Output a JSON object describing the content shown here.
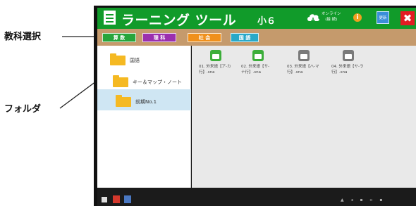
{
  "callouts": {
    "subject_select": "教科選択",
    "folder": "フォルダ"
  },
  "header": {
    "app_title": "ラーニング ツール",
    "grade": "小６",
    "online_status_line1": "オンライン",
    "online_status_line2": "(接 続)",
    "info_label": "i",
    "update_label": "更新",
    "close_label": "✖"
  },
  "subjects": [
    {
      "label": "算 数",
      "color": "#27a53b"
    },
    {
      "label": "理 科",
      "color": "#9b2fae"
    },
    {
      "label": "社 会",
      "color": "#f0901c"
    },
    {
      "label": "国 語",
      "color": "#29a9c8"
    }
  ],
  "folders": [
    {
      "label": "国語"
    },
    {
      "label": "キー＆マップ・ノート"
    },
    {
      "label": "前期No.1"
    }
  ],
  "files": [
    {
      "line1": "01. 外来語【ア-カ",
      "line2": "行】.sna",
      "icon_color": "green"
    },
    {
      "line1": "02. 外来語【サ-",
      "line2": "ナ行】.sna",
      "icon_color": "green"
    },
    {
      "line1": "03. 外来語【ハ-マ",
      "line2": "行】.sna",
      "icon_color": "gray"
    },
    {
      "line1": "04. 外来語【ヤ-ラ",
      "line2": "行】.sna",
      "icon_color": "gray"
    }
  ],
  "colors": {
    "header_green": "#119b2a",
    "subject_bar_tan": "#c59a6c",
    "close_red": "#e31b23",
    "update_blue": "#3a8fd9",
    "selected_row": "#cfe6f3"
  }
}
